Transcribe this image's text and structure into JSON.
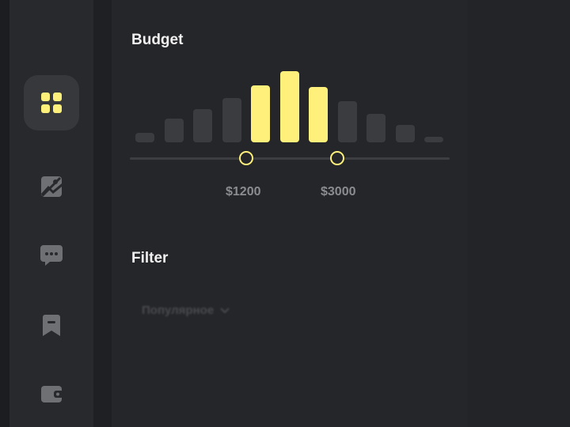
{
  "sidebar": {
    "items": [
      {
        "icon": "dashboard-grid-icon",
        "active": true,
        "color": "#fef07a"
      },
      {
        "icon": "image-off-icon",
        "active": false
      },
      {
        "icon": "chat-bubble-icon",
        "active": false
      },
      {
        "icon": "bookmark-icon",
        "active": false
      },
      {
        "icon": "wallet-icon",
        "active": false
      }
    ]
  },
  "budget": {
    "title": "Budget",
    "min_label": "$1200",
    "max_label": "$3000",
    "histogram_levels": [
      0.12,
      0.3,
      0.42,
      0.56,
      0.72,
      0.9,
      0.7,
      0.52,
      0.36,
      0.22,
      0.07
    ],
    "selected_range": [
      4,
      6
    ],
    "accent": "#fef07a"
  },
  "filter": {
    "title": "Filter",
    "select_value": "Популярное"
  }
}
